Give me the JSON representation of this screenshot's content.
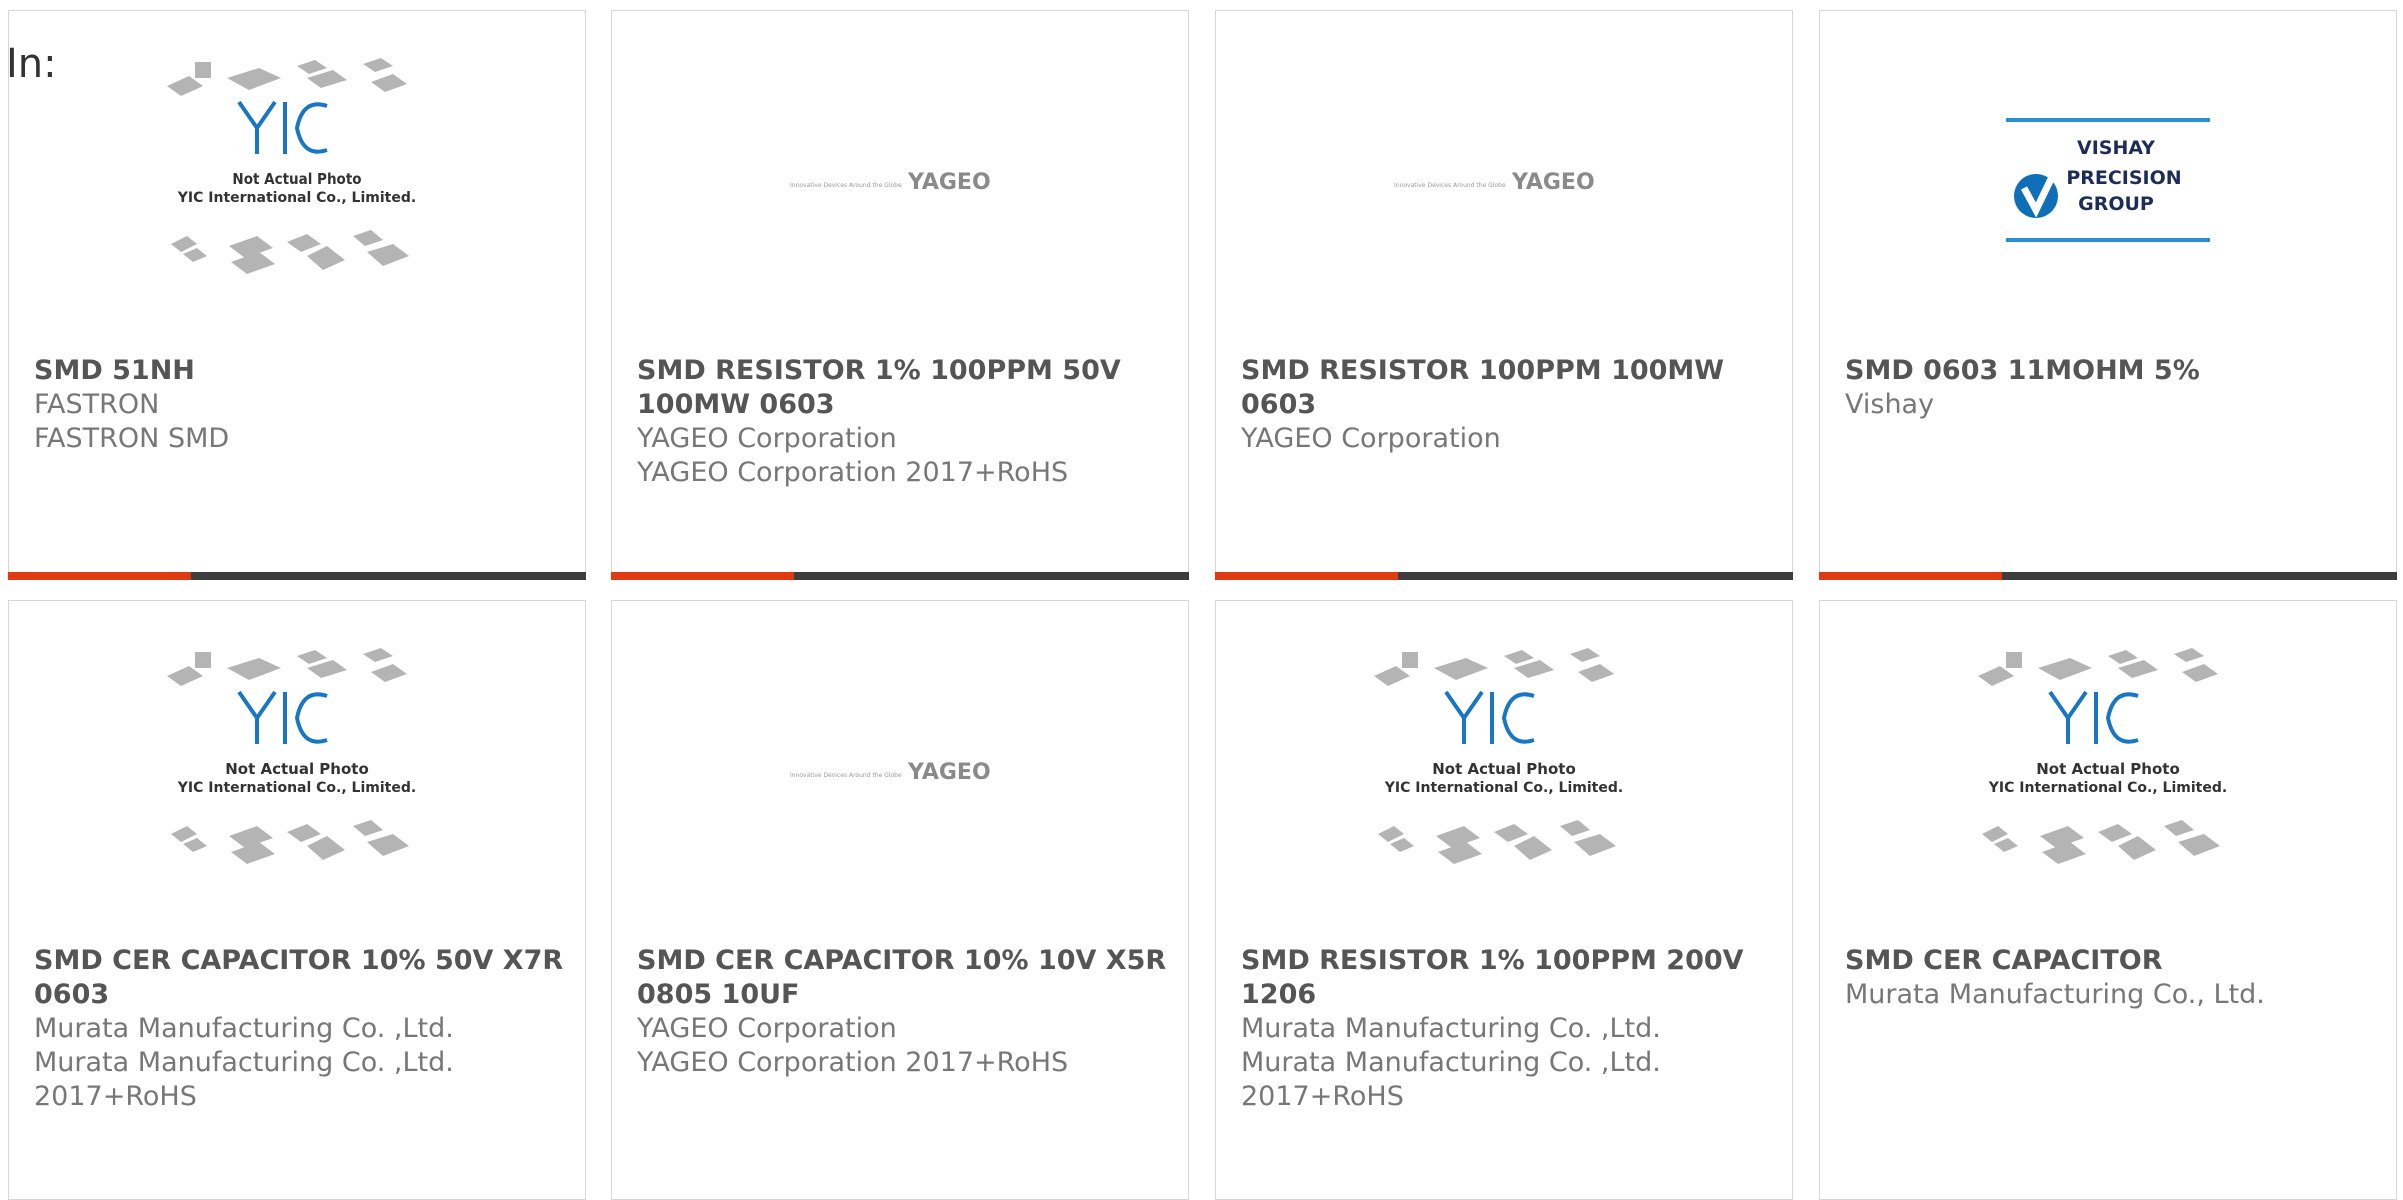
{
  "page": {
    "in_label": "In:"
  },
  "colors": {
    "accent": "#e03a12",
    "bar": "#3d3d3d"
  },
  "placeholder_image": {
    "line1": "Not Actual Photo",
    "line2": "YIC International Co., Limited.",
    "logo": "YIC"
  },
  "logos": {
    "yageo": {
      "tagline": "Innovative Devices Around the Globe",
      "name": "YAGEO"
    },
    "vishay": {
      "line1": "VISHAY",
      "line2": "PRECISION",
      "line3": "GROUP"
    }
  },
  "products": [
    {
      "image": "yic-placeholder",
      "title": "SMD 51NH",
      "lines": [
        "FASTRON",
        "FASTRON SMD"
      ]
    },
    {
      "image": "yageo-logo",
      "title": "SMD RESISTOR 1% 100PPM 50V 100MW 0603",
      "lines": [
        "YAGEO Corporation",
        "YAGEO Corporation 2017+RoHS"
      ]
    },
    {
      "image": "yageo-logo",
      "title": "SMD RESISTOR 100PPM 100MW 0603",
      "lines": [
        "YAGEO Corporation"
      ]
    },
    {
      "image": "vishay-logo",
      "title": "SMD 0603 11MOHM 5%",
      "lines": [
        "Vishay"
      ]
    },
    {
      "image": "yic-placeholder",
      "title": "SMD CER CAPACITOR 10% 50V X7R 0603",
      "lines": [
        "Murata Manufacturing Co. ,Ltd.",
        "Murata Manufacturing Co. ,Ltd. 2017+RoHS"
      ]
    },
    {
      "image": "yageo-logo",
      "title": "SMD CER CAPACITOR 10% 10V X5R 0805 10UF",
      "lines": [
        "YAGEO Corporation",
        "YAGEO Corporation 2017+RoHS"
      ]
    },
    {
      "image": "yic-placeholder",
      "title": "SMD RESISTOR 1% 100PPM 200V 1206",
      "lines": [
        "Murata Manufacturing Co. ,Ltd.",
        "Murata Manufacturing Co. ,Ltd. 2017+RoHS"
      ]
    },
    {
      "image": "yic-placeholder",
      "title": "SMD CER CAPACITOR",
      "lines": [
        "Murata Manufacturing Co., Ltd."
      ]
    }
  ]
}
